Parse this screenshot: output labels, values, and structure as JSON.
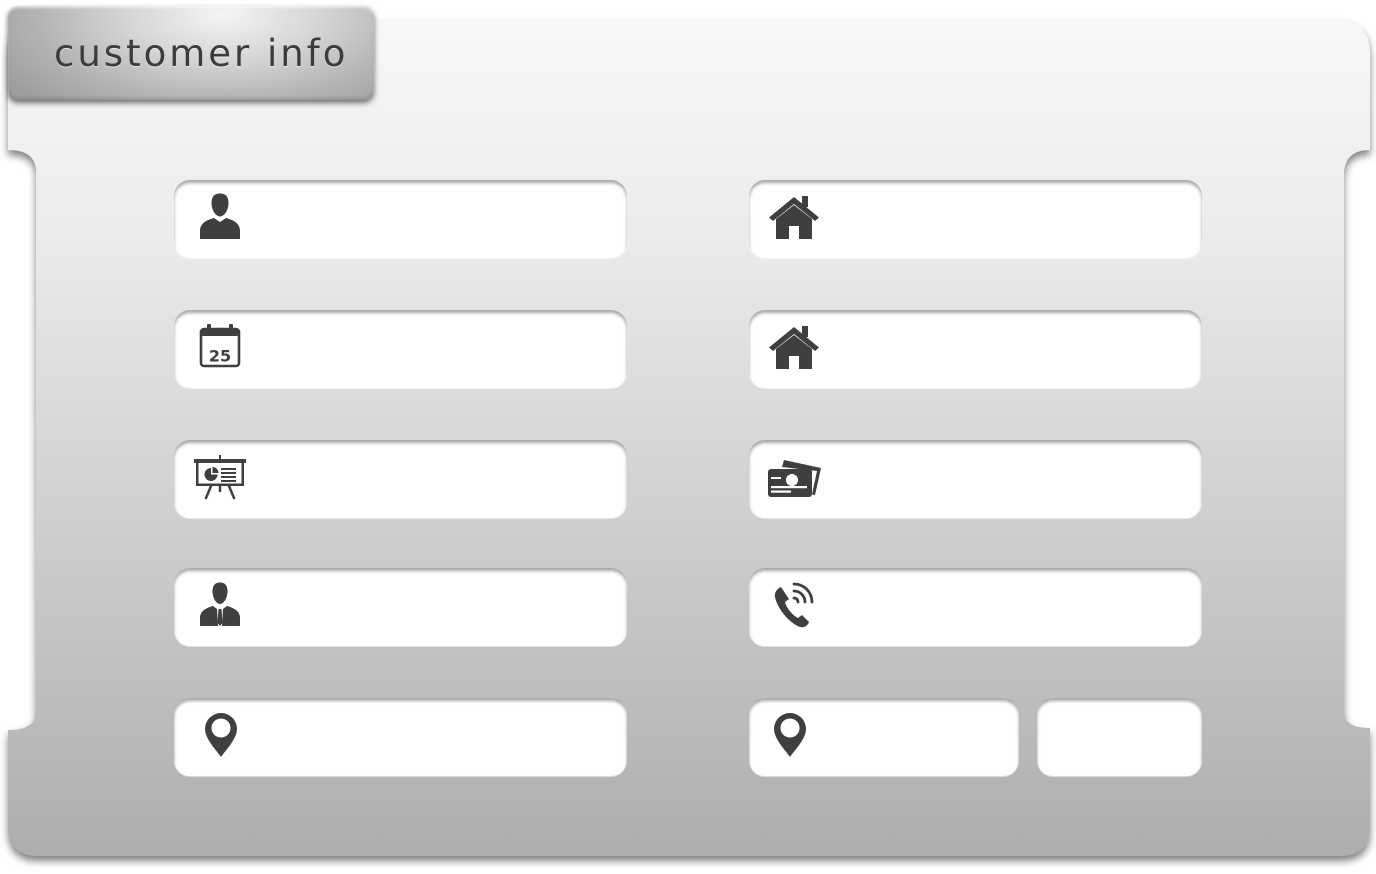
{
  "panel": {
    "title": "customer info"
  },
  "fields": {
    "name": {
      "icon": "person-icon",
      "value": "",
      "placeholder": ""
    },
    "birth_date": {
      "icon": "calendar-icon",
      "calendar_day": "25",
      "value": "",
      "placeholder": ""
    },
    "presentation": {
      "icon": "presentation-board-icon",
      "value": "",
      "placeholder": ""
    },
    "occupation": {
      "icon": "businessman-icon",
      "value": "",
      "placeholder": ""
    },
    "location": {
      "icon": "map-pin-icon",
      "value": "",
      "placeholder": ""
    },
    "home_address_1": {
      "icon": "home-icon",
      "value": "",
      "placeholder": ""
    },
    "home_address_2": {
      "icon": "home-icon",
      "value": "",
      "placeholder": ""
    },
    "id_cards": {
      "icon": "id-cards-icon",
      "value": "",
      "placeholder": ""
    },
    "phone": {
      "icon": "phone-icon",
      "value": "",
      "placeholder": ""
    },
    "city": {
      "icon": "map-pin-icon",
      "value": "",
      "placeholder": ""
    },
    "postal_code": {
      "value": "",
      "placeholder": ""
    }
  },
  "colors": {
    "icon": "#3f3f3f",
    "panel_top": "#f7f7f7",
    "panel_bottom": "#afafaf",
    "field_bg": "#ffffff"
  }
}
